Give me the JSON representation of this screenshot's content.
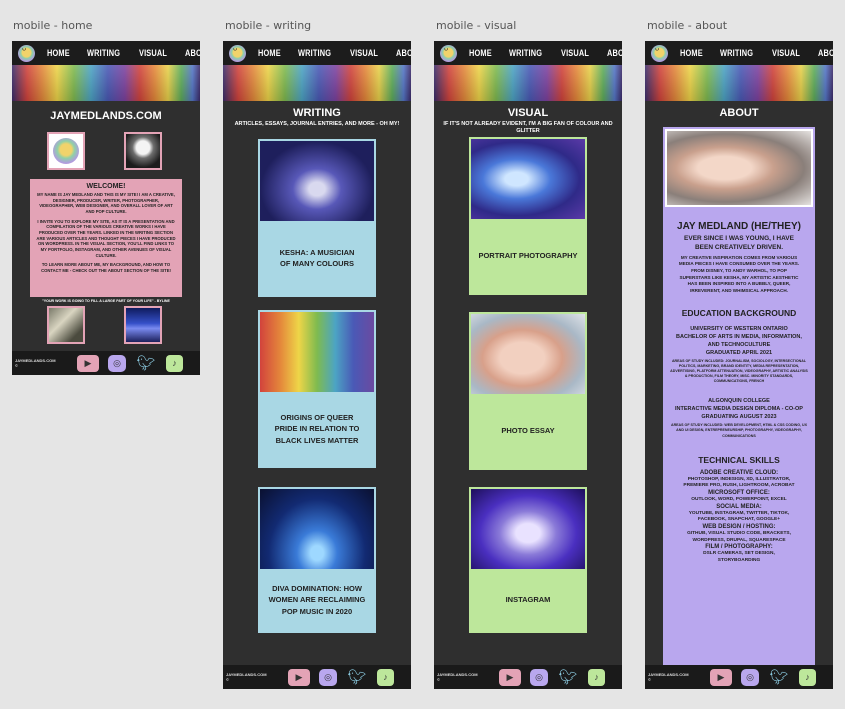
{
  "frames": {
    "home": {
      "label": "mobile - home"
    },
    "writing": {
      "label": "mobile - writing"
    },
    "visual": {
      "label": "mobile - visual"
    },
    "about": {
      "label": "mobile - about"
    }
  },
  "nav": {
    "home": "HOME",
    "writing": "WRITING",
    "visual": "VISUAL",
    "about": "ABOUT"
  },
  "footer": {
    "site": "JAYMEDLANDS.COM ©"
  },
  "social": {
    "youtube": "youtube-icon",
    "instagram": "instagram-icon",
    "twitter": "twitter-icon",
    "tiktok": "tiktok-icon"
  },
  "colors": {
    "pink": "#e3a3b6",
    "lavender": "#b9a7ee",
    "blue": "#a9d7e4",
    "green": "#bde79b",
    "dark": "#2f2f2f"
  },
  "home": {
    "site_title": "JAYMEDLANDS.COM",
    "welcome": "WELCOME!",
    "intro": "MY NAME IS JAY MEDLAND AND THIS IS MY SITE! I AM A CREATIVE, DESIGNER, PRODUCER, WRITER, PHOTOGRAPHER, VIDEOGRAPHER, WEB DESIGNER, AND OVERALL LOVER OF ART AND POP CULTURE.",
    "body": "I INVITE YOU TO EXPLORE MY SITE, AS IT IS A PRESENTATION AND COMPILATION OF THE VARIOUS CREATIVE WORKS I HAVE PRODUCED OVER THE YEARS. LINKED IN THE WRITING SECTION ARE VARIOUS ARTICLES AND THOUGHT PIECES I HAVE PRODUCED ON WORDPRESS. IN THE VISUAL SECTION, YOU'LL FIND LINKS TO MY PORTFOLIO, INSTAGRAM, AND OTHER AVENUES OF VISUAL CULTURE.",
    "contact": "TO LEARN MORE ABOUT ME, MY BACKGROUND, AND HOW TO CONTACT ME - CHECK OUT THE ABOUT SECTION OF THE SITE!",
    "quote": "\"YOUR WORK IS GOING TO FILL A LARGE PART OF YOUR LIFE\" - BYLINE"
  },
  "writing": {
    "heading": "WRITING",
    "subheading": "ARTICLES, ESSAYS, JOURNAL ENTRIES, AND MORE - OH MY!",
    "items": [
      {
        "title": "KESHA: A MUSICIAN OF MANY COLOURS"
      },
      {
        "title": "ORIGINS OF QUEER PRIDE IN RELATION TO BLACK LIVES MATTER"
      },
      {
        "title": "DIVA DOMINATION: HOW WOMEN ARE RECLAIMING POP MUSIC IN 2020"
      }
    ]
  },
  "visual": {
    "heading": "VISUAL",
    "subheading": "IF IT'S NOT ALREADY EVIDENT, I'M A BIG FAN OF COLOUR AND GLITTER",
    "items": [
      {
        "title": "PORTRAIT PHOTOGRAPHY"
      },
      {
        "title": "PHOTO ESSAY"
      },
      {
        "title": "INSTAGRAM"
      }
    ]
  },
  "about": {
    "heading": "ABOUT",
    "name": "JAY MEDLAND (HE/THEY)",
    "tagline": "EVER SINCE I WAS YOUNG, I HAVE BEEN CREATIVELY DRIVEN.",
    "bio": "MY CREATIVE INSPIRATION COMES FROM VARIOUS MEDIA PIECES I HAVE CONSUMED OVER THE YEARS. FROM DISNEY, TO ANDY WARHOL, TO POP SUPERSTARS LIKE KESHA, MY ARTISTIC AESTHETIC HAS BEEN INSPIRED INTO A BUBBLY, QUEER, IRREVERENT, AND WHIMSICAL APPROACH.",
    "education_heading": "EDUCATION BACKGROUND",
    "edu1": {
      "school": "UNIVERSITY OF WESTERN ONTARIO",
      "program": "BACHELOR OF ARTS IN MEDIA, INFORMATION, AND TECHNOCULTURE",
      "grad": "GRADUATED APRIL 2021",
      "areas": "AREAS OF STUDY INCLUDED: JOURNALISM, SOCIOLOGY, INTERSECTIONAL POLITICS, MARKETING, BRAND IDENTITY, MEDIA REPRESENTATION, ADVERTISING, PLATFORM ATTENUATION, VIDEOGRAPHY, ARTISTIC ANALYSIS & PRODUCTION, FILM THEORY, MISC. MINORITY STANDARDS, COMMUNICATIONS, FRENCH"
    },
    "edu2": {
      "school": "ALGONQUIN COLLEGE",
      "program": "INTERACTIVE MEDIA DESIGN DIPLOMA - CO-OP",
      "grad": "GRADUATING AUGUST 2023",
      "areas": "AREAS OF STUDY INCLUDED: WEB DEVELOPMENT, HTML & CSS CODING, UX AND UI DESIGN, ENTREPRENEURSHIP, PHOTOGRAPHY, VIDEOGRAPHY, COMMUNICATIONS"
    },
    "skills_heading": "TECHNICAL SKILLS",
    "skills": [
      {
        "h": "ADOBE CREATIVE CLOUD:",
        "v": "PHOTOSHOP, INDESIGN, XD, ILLUSTRATOR, PREMIERE PRO, RUSH, LIGHTROOM, ACROBAT"
      },
      {
        "h": "MICROSOFT OFFICE:",
        "v": "OUTLOOK, WORD, POWERPOINT, EXCEL"
      },
      {
        "h": "SOCIAL MEDIA:",
        "v": "YOUTUBE, INSTAGRAM, TWITTER, TIKTOK, FACEBOOK, SNAPCHAT, GOOGLE+"
      },
      {
        "h": "WEB DESIGN / HOSTING:",
        "v": "GITHUB, VISUAL STUDIO CODE, BRACKETS, WORDPRESS, DRUPAL, SQUARESPACE"
      },
      {
        "h": "FILM / PHOTOGRAPHY:",
        "v": "DSLR CAMERAS, SET DESIGN, STORYBOARDING"
      }
    ]
  }
}
